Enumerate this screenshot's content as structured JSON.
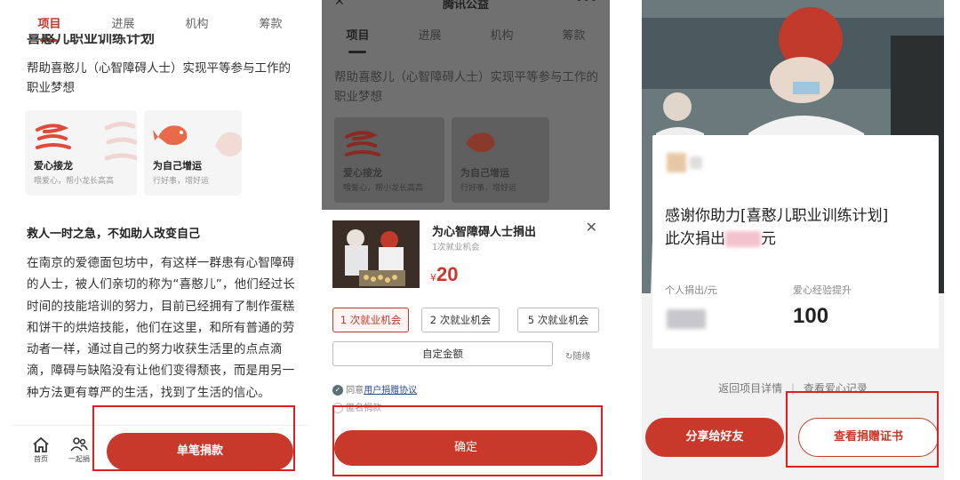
{
  "panel1": {
    "tabs": [
      "项目",
      "进展",
      "机构",
      "筹款"
    ],
    "title_cut": "喜憨儿职业训练计划",
    "subtitle": "帮助喜憨儿（心智障碍人士）实现平等参与工作的职业梦想",
    "cards": [
      {
        "title": "爱心接龙",
        "desc": "喂爱心，帮小龙长高高",
        "icon": "dragon-icon"
      },
      {
        "title": "为自己增运",
        "desc": "行好事，增好运",
        "icon": "koi-fish-icon"
      }
    ],
    "section_heading": "救人一时之急，不如助人改变自己",
    "article": "在南京的爱德面包坊中，有这样一群患有心智障碍的人士，被人们亲切的称为“喜憨儿”，他们经过长时间的技能培训的努力，目前已经拥有了制作蛋糕和饼干的烘焙技能，他们在这里，和所有普通的劳动者一样，通过自己的努力收获生活里的点点滴滴，障碍与缺陷没有让他们变得颓丧，而是用另一种方法更有尊严的生活，找到了生活的信心。",
    "nav": [
      {
        "label": "首页",
        "icon": "home-icon"
      },
      {
        "label": "一起捐",
        "icon": "people-icon"
      }
    ],
    "donate_button": "单笔捐款"
  },
  "panel2": {
    "header_title": "腾讯公益",
    "tabs": [
      "项目",
      "进展",
      "机构",
      "筹款"
    ],
    "subtitle": "帮助喜憨儿（心智障碍人士）实现平等参与工作的职业梦想",
    "cards": [
      {
        "title": "爱心接龙",
        "desc": "喂爱心，帮小龙长高高"
      },
      {
        "title": "为自己增运",
        "desc": "行好事，增好运"
      }
    ],
    "sheet": {
      "title": "为心智障碍人士捐出",
      "subtitle": "1次就业机会",
      "currency": "¥",
      "amount": "20",
      "options": [
        "1 次就业机会",
        "2 次就业机会",
        "5 次就业机会"
      ],
      "custom_amount": "自定金额",
      "random_label": "随缘",
      "agree_prefix": "同意",
      "agree_link": "用户捐赠协议",
      "anonymous": "匿名捐款",
      "confirm_button": "确定"
    }
  },
  "panel3": {
    "thanks_line1": "感谢你助力[喜憨儿职业训练计划]",
    "thanks_line2_prefix": "此次捐出",
    "thanks_line2_suffix": "元",
    "personal_label": "个人捐出/元",
    "exp_label": "爱心经验提升",
    "exp_value": "100",
    "back_link": "返回项目详情",
    "divider": "|",
    "records_link": "查看爱心记录",
    "share_button": "分享给好友",
    "cert_button": "查看捐赠证书"
  },
  "colors": {
    "accent": "#c9392b",
    "highlight_box": "#e02020",
    "overlay": "#707070"
  }
}
